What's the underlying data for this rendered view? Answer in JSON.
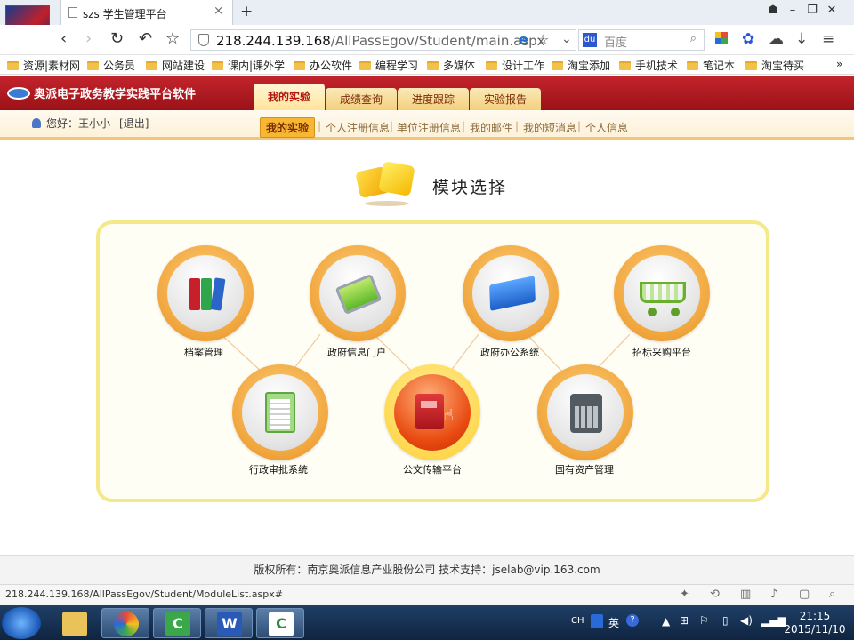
{
  "browser": {
    "tab_title": "szs  学生管理平台",
    "tab_close": "×",
    "new_tab": "+",
    "url_host": "218.244.139.168",
    "url_path": "/AllPassEgov/Student/main.aspx",
    "search_placeholder": "百度",
    "search_engine_icon": "du",
    "window_controls": [
      "☗",
      "–",
      "❐",
      "✕"
    ],
    "nav_buttons": [
      "‹",
      "›",
      "↻",
      "↶",
      "☆"
    ],
    "toolbar_icons": [
      "apps-icon",
      "baidu-paw-icon",
      "cloud-icon",
      "download-icon",
      "menu-icon"
    ],
    "bookmarks": [
      "资源|素材网",
      "公务员",
      "网站建设",
      "课内|课外学",
      "办公软件",
      "编程学习",
      "多媒体",
      "设计工作",
      "淘宝添加",
      "手机技术",
      "笔记本",
      "淘宝待买"
    ],
    "bookmark_more": "»"
  },
  "site": {
    "logo_text": "奥派电子政务教学实践平台软件",
    "main_tabs": [
      {
        "label": "我的实验",
        "active": true
      },
      {
        "label": "成绩查询",
        "active": false
      },
      {
        "label": "进度跟踪",
        "active": false
      },
      {
        "label": "实验报告",
        "active": false
      }
    ],
    "greeting": "您好：王小小",
    "logout": "[退出]",
    "sub_tabs": [
      "我的实验",
      "个人注册信息",
      "单位注册信息",
      "我的邮件",
      "我的短消息",
      "个人信息"
    ],
    "sub_sep": "|",
    "module_title": "模块选择",
    "modules": [
      {
        "label": "档案管理",
        "icon": "binders-icon"
      },
      {
        "label": "政府信息门户",
        "icon": "pda-icon"
      },
      {
        "label": "政府办公系统",
        "icon": "folder-icon"
      },
      {
        "label": "招标采购平台",
        "icon": "cart-icon"
      },
      {
        "label": "行政审批系统",
        "icon": "clipboard-icon"
      },
      {
        "label": "公文传输平台",
        "icon": "document-icon"
      },
      {
        "label": "国有资产管理",
        "icon": "calculator-icon"
      }
    ],
    "footer": "版权所有：南京奥派信息产业股份公司     技术支持：jselab@vip.163.com"
  },
  "statusbar": {
    "url": "218.244.139.168/AllPassEgov/Student/ModuleList.aspx#"
  },
  "taskbar": {
    "apps": [
      "explorer",
      "chrome-like",
      "camtasia",
      "word",
      "camtasia2"
    ],
    "tray_lang": "CH",
    "tray_ime": "英",
    "time": "21:15",
    "date": "2015/11/10"
  },
  "colors": {
    "header_red": "#b51a22",
    "accent_orange": "#f0a53c",
    "panel_border": "#f4e889"
  }
}
